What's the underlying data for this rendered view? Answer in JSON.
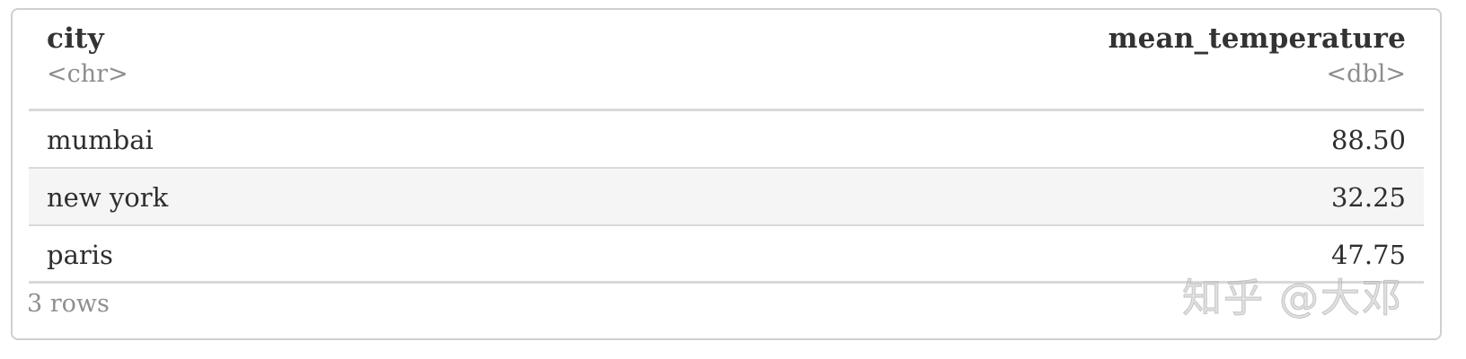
{
  "table": {
    "columns": [
      {
        "name": "city",
        "type": "<chr>"
      },
      {
        "name": "mean_temperature",
        "type": "<dbl>"
      }
    ],
    "rows": [
      {
        "city": "mumbai",
        "mean_temperature": "88.50"
      },
      {
        "city": "new york",
        "mean_temperature": "32.25"
      },
      {
        "city": "paris",
        "mean_temperature": "47.75"
      }
    ],
    "footer": "3 rows"
  },
  "watermark": "知乎 @大邓"
}
